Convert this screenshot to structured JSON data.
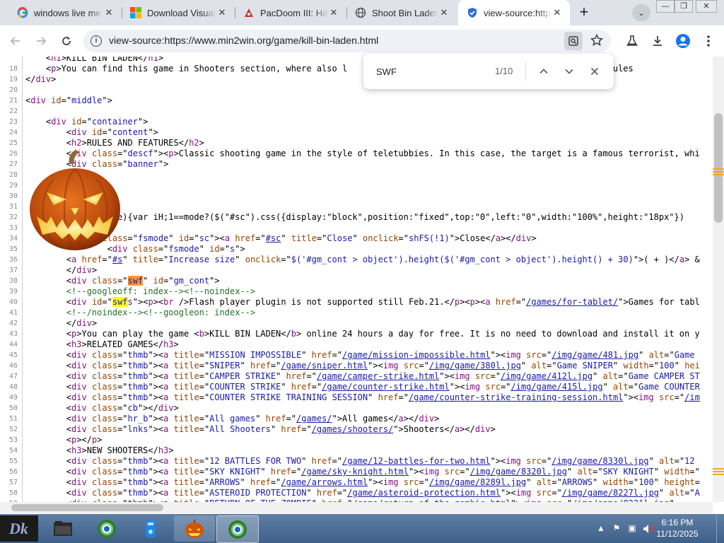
{
  "tabs": [
    {
      "label": "windows live me",
      "favicon": "google-icon",
      "active": false
    },
    {
      "label": "Download Visual",
      "favicon": "windows-icon",
      "active": false
    },
    {
      "label": "PacDoom III: Hal",
      "favicon": "pacdoom-icon",
      "active": false
    },
    {
      "label": "Shoot Bin Laden",
      "favicon": "globe-icon",
      "active": false
    },
    {
      "label": "view-source:http",
      "favicon": "shield-icon",
      "active": true
    }
  ],
  "window_controls": {
    "minimize": "—",
    "restore": "❐",
    "close": "✕"
  },
  "address_bar": {
    "url": "view-source:https://www.min2win.org/game/kill-bin-laden.html"
  },
  "find_bar": {
    "query": "SWF",
    "count": "1/10"
  },
  "colors": {
    "tag": "#881280",
    "attr": "#994500",
    "value": "#1a1aa6",
    "comment": "#236e25",
    "highlight": "#ffff00",
    "current_highlight": "#ff9632",
    "taskbar": "#4a6b94"
  },
  "source_lines": [
    {
      "n": "",
      "html": "    &lt;<span class=\"tag\">h1</span>&gt;KILL BIN LADEN&lt;/<span class=\"tag\">h1</span>&gt;"
    },
    {
      "n": "18",
      "html": "    &lt;<span class=\"tag\">p</span>&gt;You can find this game in Shooters section, where also l                                    d how to play, rules"
    },
    {
      "n": "19",
      "html": "&lt;/<span class=\"tag\">div</span>&gt;"
    },
    {
      "n": "20",
      "html": ""
    },
    {
      "n": "21",
      "html": "&lt;<span class=\"tag\">div</span> <span class=\"attr\">id</span>=\"<span class=\"val\">middle</span>\"&gt;"
    },
    {
      "n": "22",
      "html": ""
    },
    {
      "n": "23",
      "html": "    &lt;<span class=\"tag\">div</span> <span class=\"attr\">id</span>=\"<span class=\"val\">container</span>\"&gt;"
    },
    {
      "n": "24",
      "html": "        &lt;<span class=\"tag\">div</span> <span class=\"attr\">id</span>=\"<span class=\"val\">content</span>\"&gt;"
    },
    {
      "n": "25",
      "html": "        &lt;<span class=\"tag\">h2</span>&gt;RULES AND FEATURES&lt;/<span class=\"tag\">h2</span>&gt;"
    },
    {
      "n": "26",
      "html": "        &lt;<span class=\"tag\">div</span> <span class=\"attr\">class</span>=\"<span class=\"val\">descf</span>\"&gt;&lt;<span class=\"tag\">p</span>&gt;Classic shooting game in the style of teletubbies. In this case, the target is a famous terrorist, whi"
    },
    {
      "n": "27",
      "html": "        &lt;<span class=\"tag\">div</span> <span class=\"attr\">class</span>=\"<span class=\"val\">banner</span>\"&gt;"
    },
    {
      "n": "28",
      "html": ""
    },
    {
      "n": "29",
      "html": ""
    },
    {
      "n": "30",
      "html": ""
    },
    {
      "n": "31",
      "html": ""
    },
    {
      "n": "32",
      "html": "          shFS(mode){var iH;1==mode?($(\"#sc\").css({display:\"block\",position:\"fixed\",top:\"0\",left:\"0\",width:\"100%\",height:\"18px\"})"
    },
    {
      "n": "33",
      "html": ""
    },
    {
      "n": "34",
      "html": "          &lt;<span class=\"tag\">div</span> <span class=\"attr\">class</span>=\"<span class=\"val\">fsmode</span>\" <span class=\"attr\">id</span>=\"<span class=\"val\">sc</span>\"&gt;&lt;<span class=\"tag\">a</span> <span class=\"attr\">href</span>=\"<span class=\"link\">#sc</span>\" <span class=\"attr\">title</span>=\"<span class=\"val\">Close</span>\" <span class=\"attr\">onclick</span>=\"<span class=\"val\">shFS(!1)</span>\"&gt;Close&lt;/<span class=\"tag\">a</span>&gt;&lt;/<span class=\"tag\">div</span>&gt;"
    },
    {
      "n": "35",
      "html": "                &lt;<span class=\"tag\">div</span> <span class=\"attr\">class</span>=\"<span class=\"val\">fsmode</span>\" <span class=\"attr\">id</span>=\"<span class=\"val\">s</span>\"&gt;"
    },
    {
      "n": "36",
      "html": "        &lt;<span class=\"tag\">a</span> <span class=\"attr\">href</span>=\"<span class=\"link\">#s</span>\" <span class=\"attr\">title</span>=\"<span class=\"val\">Increase size</span>\" <span class=\"attr\">onclick</span>=\"<span class=\"val\">$('#gm_cont &gt; object').height($('#gm_cont &gt; object').height() + 30)</span>\"&gt;( + )&lt;/<span class=\"tag\">a</span>&gt; &amp;"
    },
    {
      "n": "37",
      "html": "        &lt;/<span class=\"tag\">div</span>&gt;"
    },
    {
      "n": "38",
      "html": "        &lt;<span class=\"tag\">div</span> <span class=\"attr\">class</span>=\"<span class=\"val\"><span class=\"hl-cur\">swf</span></span>\" <span class=\"attr\">id</span>=\"<span class=\"val\">gm_cont</span>\"&gt;"
    },
    {
      "n": "39",
      "html": "        <span class=\"cmt\">&lt;!--googleoff: index--&gt;&lt;!--noindex--&gt;</span>"
    },
    {
      "n": "40",
      "html": "        &lt;<span class=\"tag\">div</span> <span class=\"attr\">id</span>=\"<span class=\"val\"><span class=\"hl\">swf</span>s</span>\"&gt;&lt;<span class=\"tag\">p</span>&gt;&lt;<span class=\"tag\">br</span> /&gt;Flash player plugin is not supported still Feb.21.&lt;/<span class=\"tag\">p</span>&gt;&lt;<span class=\"tag\">p</span>&gt;&lt;<span class=\"tag\">a</span> <span class=\"attr\">href</span>=\"<span class=\"link\">/games/for-tablet/</span>\"&gt;Games for tabl"
    },
    {
      "n": "41",
      "html": "        <span class=\"cmt\">&lt;!--/noindex--&gt;&lt;!--googleon: index--&gt;</span>"
    },
    {
      "n": "42",
      "html": "        &lt;/<span class=\"tag\">div</span>&gt;"
    },
    {
      "n": "43",
      "html": "        &lt;<span class=\"tag\">p</span>&gt;You can play the game &lt;<span class=\"tag\">b</span>&gt;KILL BIN LADEN&lt;/<span class=\"tag\">b</span>&gt; online 24 hours a day for free. It is no need to download and install it on y"
    },
    {
      "n": "44",
      "html": "        &lt;<span class=\"tag\">h3</span>&gt;RELATED GAMES&lt;/<span class=\"tag\">h3</span>&gt;"
    },
    {
      "n": "45",
      "html": "        &lt;<span class=\"tag\">div</span> <span class=\"attr\">class</span>=\"<span class=\"val\">thmb</span>\"&gt;&lt;<span class=\"tag\">a</span> <span class=\"attr\">title</span>=\"<span class=\"val\">MISSION IMPOSSIBLE</span>\" <span class=\"attr\">href</span>=\"<span class=\"link\">/game/mission-impossible.html</span>\"&gt;&lt;<span class=\"tag\">img</span> <span class=\"attr\">src</span>=\"<span class=\"link\">/img/game/481.jpg</span>\" <span class=\"attr\">alt</span>=\"<span class=\"val\">Game</span>"
    },
    {
      "n": "46",
      "html": "        &lt;<span class=\"tag\">div</span> <span class=\"attr\">class</span>=\"<span class=\"val\">thmb</span>\"&gt;&lt;<span class=\"tag\">a</span> <span class=\"attr\">title</span>=\"<span class=\"val\">SNIPER</span>\" <span class=\"attr\">href</span>=\"<span class=\"link\">/game/sniper.html</span>\"&gt;&lt;<span class=\"tag\">img</span> <span class=\"attr\">src</span>=\"<span class=\"link\">/img/game/380l.jpg</span>\" <span class=\"attr\">alt</span>=\"<span class=\"val\">Game SNIPER</span>\" <span class=\"attr\">width</span>=\"<span class=\"val\">100</span>\" <span class=\"attr\">hei</span>"
    },
    {
      "n": "47",
      "html": "        &lt;<span class=\"tag\">div</span> <span class=\"attr\">class</span>=\"<span class=\"val\">thmb</span>\"&gt;&lt;<span class=\"tag\">a</span> <span class=\"attr\">title</span>=\"<span class=\"val\">CAMPER STRIKE</span>\" <span class=\"attr\">href</span>=\"<span class=\"link\">/game/camper-strike.html</span>\"&gt;&lt;<span class=\"tag\">img</span> <span class=\"attr\">src</span>=\"<span class=\"link\">/img/game/412l.jpg</span>\" <span class=\"attr\">alt</span>=\"<span class=\"val\">Game CAMPER ST</span>"
    },
    {
      "n": "48",
      "html": "        &lt;<span class=\"tag\">div</span> <span class=\"attr\">class</span>=\"<span class=\"val\">thmb</span>\"&gt;&lt;<span class=\"tag\">a</span> <span class=\"attr\">title</span>=\"<span class=\"val\">COUNTER STRIKE</span>\" <span class=\"attr\">href</span>=\"<span class=\"link\">/game/counter-strike.html</span>\"&gt;&lt;<span class=\"tag\">img</span> <span class=\"attr\">src</span>=\"<span class=\"link\">/img/game/415l.jpg</span>\" <span class=\"attr\">alt</span>=\"<span class=\"val\">Game COUNTER</span>"
    },
    {
      "n": "49",
      "html": "        &lt;<span class=\"tag\">div</span> <span class=\"attr\">class</span>=\"<span class=\"val\">thmb</span>\"&gt;&lt;<span class=\"tag\">a</span> <span class=\"attr\">title</span>=\"<span class=\"val\">COUNTER STRIKE TRAINING SESSION</span>\" <span class=\"attr\">href</span>=\"<span class=\"link\">/game/counter-strike-training-session.html</span>\"&gt;&lt;<span class=\"tag\">img</span> <span class=\"attr\">src</span>=\"<span class=\"link\">/im</span>"
    },
    {
      "n": "50",
      "html": "        &lt;<span class=\"tag\">div</span> <span class=\"attr\">class</span>=\"<span class=\"val\">cb</span>\"&gt;&lt;/<span class=\"tag\">div</span>&gt;"
    },
    {
      "n": "51",
      "html": "        &lt;<span class=\"tag\">div</span> <span class=\"attr\">class</span>=\"<span class=\"val\">hr_b</span>\"&gt;&lt;<span class=\"tag\">a</span> <span class=\"attr\">title</span>=\"<span class=\"val\">All games</span>\" <span class=\"attr\">href</span>=\"<span class=\"link\">/games/</span>\"&gt;All games&lt;/<span class=\"tag\">a</span>&gt;&lt;/<span class=\"tag\">div</span>&gt;"
    },
    {
      "n": "52",
      "html": "        &lt;<span class=\"tag\">div</span> <span class=\"attr\">class</span>=\"<span class=\"val\">lnks</span>\"&gt;&lt;<span class=\"tag\">a</span> <span class=\"attr\">title</span>=\"<span class=\"val\">All Shooters</span>\" <span class=\"attr\">href</span>=\"<span class=\"link\">/games/shooters/</span>\"&gt;Shooters&lt;/<span class=\"tag\">a</span>&gt;&lt;/<span class=\"tag\">div</span>&gt;"
    },
    {
      "n": "53",
      "html": "        &lt;<span class=\"tag\">p</span>&gt;&lt;/<span class=\"tag\">p</span>&gt;"
    },
    {
      "n": "54",
      "html": "        &lt;<span class=\"tag\">h3</span>&gt;NEW SHOOTERS&lt;/<span class=\"tag\">h3</span>&gt;"
    },
    {
      "n": "55",
      "html": "        &lt;<span class=\"tag\">div</span> <span class=\"attr\">class</span>=\"<span class=\"val\">thmb</span>\"&gt;&lt;<span class=\"tag\">a</span> <span class=\"attr\">title</span>=\"<span class=\"val\">12 BATTLES FOR TWO</span>\" <span class=\"attr\">href</span>=\"<span class=\"link\">/game/12-battles-for-two.html</span>\"&gt;&lt;<span class=\"tag\">img</span> <span class=\"attr\">src</span>=\"<span class=\"link\">/img/game/8330l.jpg</span>\" <span class=\"attr\">alt</span>=\"<span class=\"val\">12</span>"
    },
    {
      "n": "56",
      "html": "        &lt;<span class=\"tag\">div</span> <span class=\"attr\">class</span>=\"<span class=\"val\">thmb</span>\"&gt;&lt;<span class=\"tag\">a</span> <span class=\"attr\">title</span>=\"<span class=\"val\">SKY KNIGHT</span>\" <span class=\"attr\">href</span>=\"<span class=\"link\">/game/sky-knight.html</span>\"&gt;&lt;<span class=\"tag\">img</span> <span class=\"attr\">src</span>=\"<span class=\"link\">/img/game/8320l.jpg</span>\" <span class=\"attr\">alt</span>=\"<span class=\"val\">SKY KNIGHT</span>\" <span class=\"attr\">width</span>=\""
    },
    {
      "n": "57",
      "html": "        &lt;<span class=\"tag\">div</span> <span class=\"attr\">class</span>=\"<span class=\"val\">thmb</span>\"&gt;&lt;<span class=\"tag\">a</span> <span class=\"attr\">title</span>=\"<span class=\"val\">ARROWS</span>\" <span class=\"attr\">href</span>=\"<span class=\"link\">/game/arrows.html</span>\"&gt;&lt;<span class=\"tag\">img</span> <span class=\"attr\">src</span>=\"<span class=\"link\">/img/game/8289l.jpg</span>\" <span class=\"attr\">alt</span>=\"<span class=\"val\">ARROWS</span>\" <span class=\"attr\">width</span>=\"<span class=\"val\">100</span>\" <span class=\"attr\">height</span>="
    },
    {
      "n": "58",
      "html": "        &lt;<span class=\"tag\">div</span> <span class=\"attr\">class</span>=\"<span class=\"val\">thmb</span>\"&gt;&lt;<span class=\"tag\">a</span> <span class=\"attr\">title</span>=\"<span class=\"val\">ASTEROID PROTECTION</span>\" <span class=\"attr\">href</span>=\"<span class=\"link\">/game/asteroid-protection.html</span>\"&gt;&lt;<span class=\"tag\">img</span> <span class=\"attr\">src</span>=\"<span class=\"link\">/img/game/8227l.jpg</span>\" <span class=\"attr\">alt</span>=\"<span class=\"val\">A</span>"
    },
    {
      "n": "59",
      "html": "        &lt;<span class=\"tag\">div</span> <span class=\"attr\">class</span>=\"<span class=\"val\">thmb</span>\"&gt;&lt;<span class=\"tag\">a</span> <span class=\"attr\">title</span>=\"<span class=\"val\">RETURN OF THE ZOMBIE</span>\" <span class=\"attr\">href</span>=\"<span class=\"link\">/game/return-of-the-zombie.html</span>\"&gt;&lt;<span class=\"tag\">img</span> <span class=\"attr\">src</span>=\"<span class=\"link\">/img/game/8221l.jpg</span>\""
    }
  ],
  "taskbar": {
    "buttons": [
      {
        "name": "taskbar-start-button",
        "icon": "start-orb-icon"
      },
      {
        "name": "taskbar-explorer-button",
        "icon": "folder-icon"
      },
      {
        "name": "taskbar-chrome-button",
        "icon": "chrome-icon"
      },
      {
        "name": "taskbar-app-button",
        "icon": "app-icon"
      },
      {
        "name": "taskbar-pumpkin-button",
        "icon": "pumpkin-icon"
      },
      {
        "name": "taskbar-chrome-active-button",
        "icon": "chrome-icon"
      }
    ],
    "time": "6:16 PM",
    "date": "11/12/2025"
  }
}
